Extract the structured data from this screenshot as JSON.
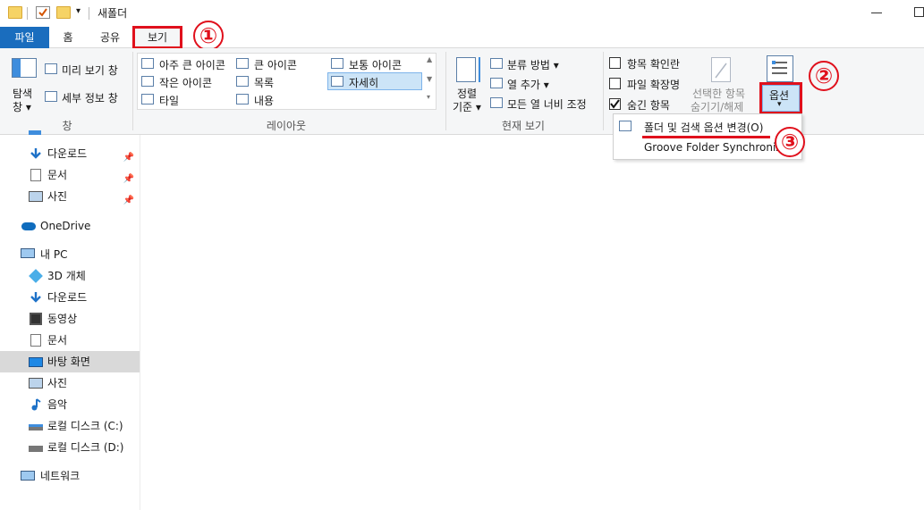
{
  "titlebar": {
    "title": "새폴더",
    "qat_arrow": "▾"
  },
  "tabs": [
    {
      "label": "파일"
    },
    {
      "label": "홈"
    },
    {
      "label": "공유"
    },
    {
      "label": "보기"
    }
  ],
  "ribbon": {
    "pane_group": {
      "label": "창",
      "nav_pane": "탐색",
      "nav_pane2": "창 ▾",
      "preview_pane": "미리 보기 창",
      "details_pane": "세부 정보 창"
    },
    "layout_group": {
      "label": "레이아웃",
      "items": [
        "아주 큰 아이콘",
        "큰 아이콘",
        "보통 아이콘",
        "작은 아이콘",
        "목록",
        "자세히",
        "타일",
        "내용"
      ],
      "selected": "자세히"
    },
    "current_view_group": {
      "label": "현재 보기",
      "sort_by": "정렬",
      "sort_by2": "기준 ▾",
      "group_by": "분류 방법 ▾",
      "add_columns": "열 추가 ▾",
      "size_columns": "모든 열 너비 조정"
    },
    "show_hide_group": {
      "item_checkboxes": "항목 확인란",
      "file_extensions": "파일 확장명",
      "hidden_items": "숨긴 항목",
      "hide_selected": "선택한 항목",
      "hide_selected2": "숨기기/해제",
      "hidden_items_checked": true
    },
    "options": {
      "label": "옵션",
      "arrow": "▾"
    }
  },
  "dropdown": {
    "items": [
      {
        "label": "폴더 및 검색 옵션 변경(O)"
      },
      {
        "label": "Groove Folder Synchronization"
      }
    ]
  },
  "annotations": {
    "one": "①",
    "two": "②",
    "three": "③",
    "color": "#e0101c"
  },
  "nav": {
    "quick_access": [
      {
        "label": "다운로드",
        "icon": "download-icon",
        "pinned": "📌"
      },
      {
        "label": "문서",
        "icon": "document-icon",
        "pinned": "📌"
      },
      {
        "label": "사진",
        "icon": "picture-icon",
        "pinned": "📌"
      }
    ],
    "onedrive": "OneDrive",
    "this_pc": "내 PC",
    "pc_items": [
      {
        "label": "3D 개체",
        "icon": "3d-objects-icon"
      },
      {
        "label": "다운로드",
        "icon": "download-icon"
      },
      {
        "label": "동영상",
        "icon": "video-icon"
      },
      {
        "label": "문서",
        "icon": "document-icon"
      },
      {
        "label": "바탕 화면",
        "icon": "desktop-icon"
      },
      {
        "label": "사진",
        "icon": "picture-icon"
      },
      {
        "label": "음악",
        "icon": "music-icon"
      },
      {
        "label": "로컬 디스크 (C:)",
        "icon": "drive-c-icon"
      },
      {
        "label": "로컬 디스크 (D:)",
        "icon": "drive-d-icon"
      }
    ],
    "network": "네트워크",
    "selected": "바탕 화면"
  }
}
